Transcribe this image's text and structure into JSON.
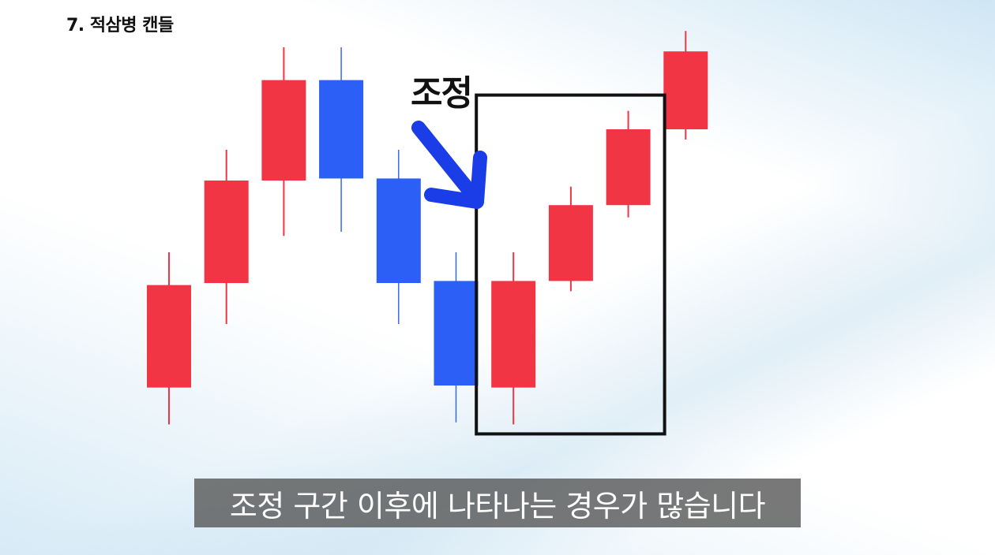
{
  "title": "7. 적삼병 캔들",
  "annotation": "조정",
  "subtitle": "조정 구간 이후에 나타나는 경우가 많습니다",
  "colors": {
    "bullish": "#f13545",
    "bearish": "#2b5ff5",
    "arrow": "#1a3de8",
    "highlight_box": "#111111"
  },
  "chart_data": {
    "type": "candlestick",
    "title": "",
    "xlabel": "",
    "ylabel": "",
    "ylim": [
      0,
      100
    ],
    "grid": false,
    "axes_visible": false,
    "highlight_box_around_candles": [
      7,
      8,
      9
    ],
    "candles": [
      {
        "index": 1,
        "direction": "up",
        "open": 17,
        "close": 42,
        "low": 8,
        "high": 50
      },
      {
        "index": 2,
        "direction": "up",
        "open": 42.5,
        "close": 67.5,
        "low": 32.5,
        "high": 75
      },
      {
        "index": 3,
        "direction": "up",
        "open": 67.5,
        "close": 92,
        "low": 54,
        "high": 100
      },
      {
        "index": 4,
        "direction": "down",
        "open": 92,
        "close": 68,
        "low": 55,
        "high": 100
      },
      {
        "index": 5,
        "direction": "down",
        "open": 68,
        "close": 42.5,
        "low": 32.5,
        "high": 75
      },
      {
        "index": 6,
        "direction": "down",
        "open": 43,
        "close": 17.5,
        "low": 8.5,
        "high": 50
      },
      {
        "index": 7,
        "direction": "up",
        "open": 17,
        "close": 43,
        "low": 8,
        "high": 50
      },
      {
        "index": 8,
        "direction": "up",
        "open": 43,
        "close": 61.5,
        "low": 40.5,
        "high": 66
      },
      {
        "index": 9,
        "direction": "up",
        "open": 61.5,
        "close": 80,
        "low": 58.5,
        "high": 84.5
      },
      {
        "index": 10,
        "direction": "up",
        "open": 80,
        "close": 99,
        "low": 77.5,
        "high": 104
      }
    ]
  }
}
